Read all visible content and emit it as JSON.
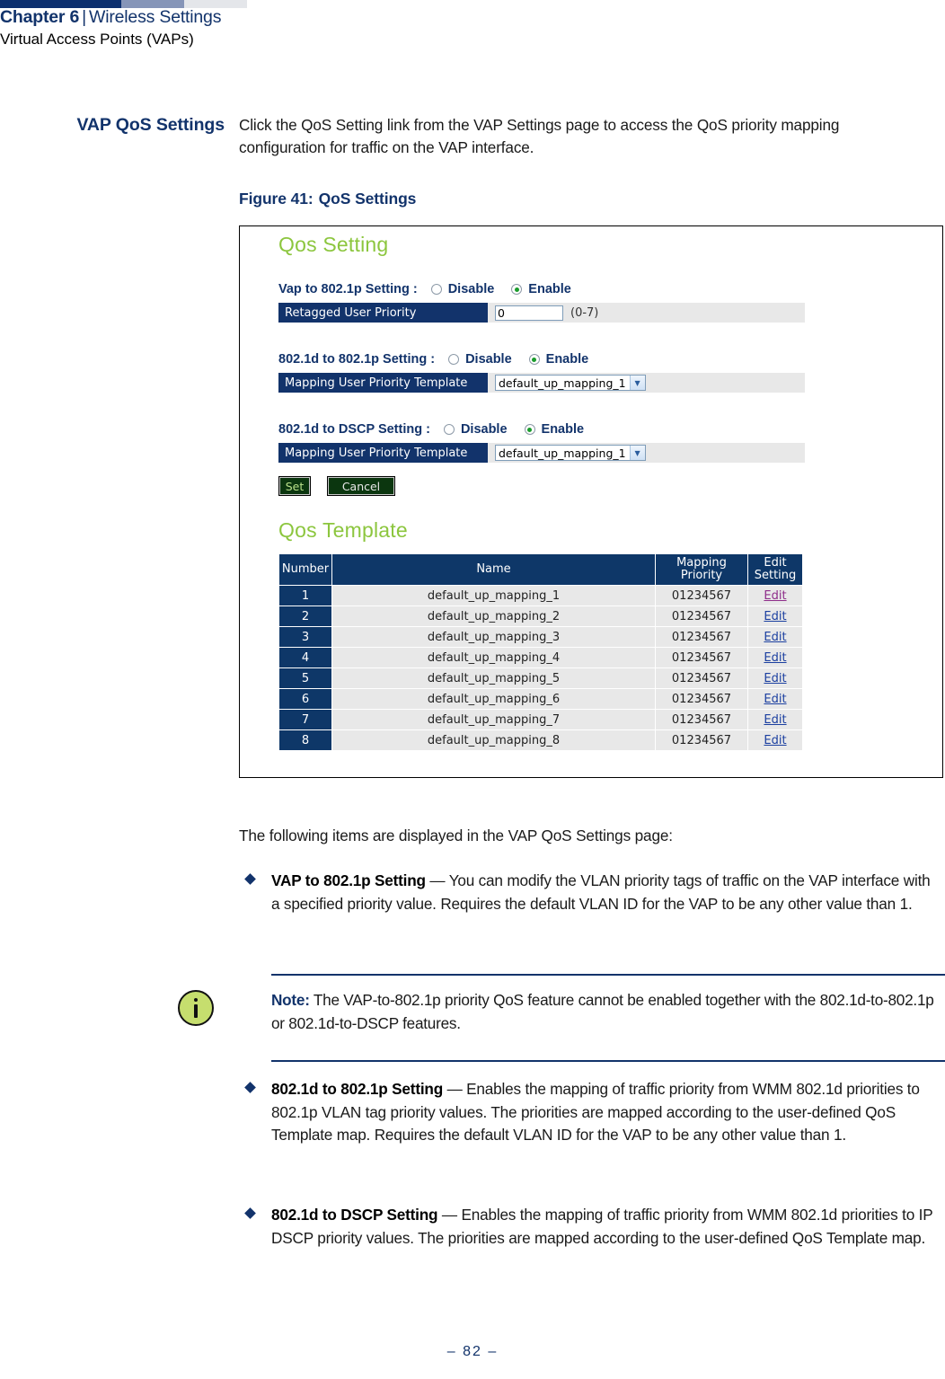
{
  "header": {
    "chapter": "Chapter 6",
    "separator": "|",
    "chapter_title": "Wireless Settings",
    "subtitle": "Virtual Access Points (VAPs)",
    "bar_colors": [
      "#0c2f6e",
      "#8695b8",
      "#e4e6ea"
    ]
  },
  "section": {
    "heading": "VAP QoS Settings",
    "intro": "Click the QoS Setting link from the VAP Settings page to access the QoS priority mapping configuration for traffic on the VAP interface."
  },
  "figure": {
    "caption_label": "Figure 41:",
    "caption_title": "QoS Settings"
  },
  "screenshot": {
    "title_qos_setting": "Qos Setting",
    "title_qos_template": "Qos Template",
    "accent_color": "#8cc63e",
    "header_color": "#12336b",
    "groups": [
      {
        "label": "Vap to 802.1p Setting :",
        "options": [
          {
            "label": "Disable",
            "selected": false
          },
          {
            "label": "Enable",
            "selected": true
          }
        ],
        "field_label": "Retagged User Priority",
        "field_type": "text",
        "field_value": "0",
        "field_hint": "(0-7)"
      },
      {
        "label": "802.1d to 802.1p Setting :",
        "options": [
          {
            "label": "Disable",
            "selected": false
          },
          {
            "label": "Enable",
            "selected": true
          }
        ],
        "field_label": "Mapping User Priority Template",
        "field_type": "select",
        "field_value": "default_up_mapping_1",
        "field_hint": ""
      },
      {
        "label": "802.1d to DSCP Setting :",
        "options": [
          {
            "label": "Disable",
            "selected": false
          },
          {
            "label": "Enable",
            "selected": true
          }
        ],
        "field_label": "Mapping User Priority Template",
        "field_type": "select",
        "field_value": "default_up_mapping_1",
        "field_hint": ""
      }
    ],
    "buttons": {
      "set": "Set",
      "cancel": "Cancel"
    },
    "table": {
      "columns": [
        "Number",
        "Name",
        "Mapping Priority",
        "Edit Setting"
      ],
      "column_mapping_line1": "Mapping",
      "column_mapping_line2": "Priority",
      "column_edit_line1": "Edit",
      "column_edit_line2": "Setting",
      "rows": [
        {
          "number": "1",
          "name": "default_up_mapping_1",
          "priority": "01234567",
          "edit": "Edit",
          "visited": true
        },
        {
          "number": "2",
          "name": "default_up_mapping_2",
          "priority": "01234567",
          "edit": "Edit",
          "visited": false
        },
        {
          "number": "3",
          "name": "default_up_mapping_3",
          "priority": "01234567",
          "edit": "Edit",
          "visited": false
        },
        {
          "number": "4",
          "name": "default_up_mapping_4",
          "priority": "01234567",
          "edit": "Edit",
          "visited": false
        },
        {
          "number": "5",
          "name": "default_up_mapping_5",
          "priority": "01234567",
          "edit": "Edit",
          "visited": false
        },
        {
          "number": "6",
          "name": "default_up_mapping_6",
          "priority": "01234567",
          "edit": "Edit",
          "visited": false
        },
        {
          "number": "7",
          "name": "default_up_mapping_7",
          "priority": "01234567",
          "edit": "Edit",
          "visited": false
        },
        {
          "number": "8",
          "name": "default_up_mapping_8",
          "priority": "01234567",
          "edit": "Edit",
          "visited": false
        }
      ]
    }
  },
  "body": {
    "lead_in": "The following items are displayed in the VAP QoS Settings page:",
    "bullets": [
      {
        "term": "VAP to 802.1p Setting",
        "dash": " — ",
        "text": "You can modify the VLAN priority tags of traffic on the VAP interface with a specified priority value. Requires the default VLAN ID for the VAP to be any other value than 1."
      },
      {
        "term": "802.1d to 802.1p Setting",
        "dash": " — ",
        "text": "Enables the mapping of traffic priority from WMM 802.1d priorities to 802.1p VLAN tag priority values. The priorities are mapped according to the user-defined QoS Template map. Requires the default VLAN ID for the VAP to be any other value than 1."
      },
      {
        "term": "802.1d to DSCP Setting",
        "dash": " — ",
        "text": "Enables the mapping of traffic priority from WMM 802.1d priorities to IP DSCP priority values. The priorities are mapped according to the user-defined QoS Template map."
      }
    ],
    "note": {
      "label": "Note:",
      "text": " The VAP-to-802.1p priority QoS feature cannot be enabled together with the 802.1d-to-802.1p or 802.1d-to-DSCP features."
    }
  },
  "footer": {
    "page": "–  82  –"
  }
}
